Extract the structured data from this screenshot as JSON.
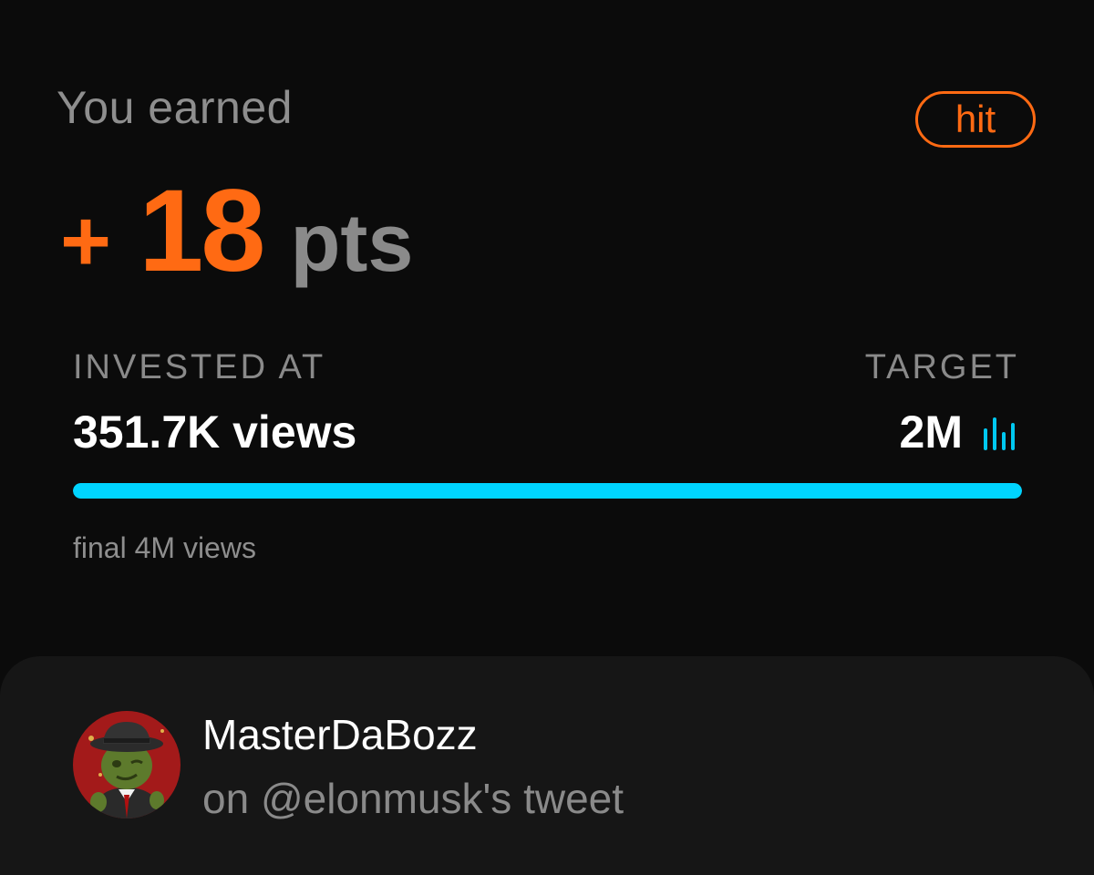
{
  "result": {
    "earned_label": "You earned",
    "badge": "hit",
    "points_sign": "+",
    "points_value": "18",
    "points_unit": "pts"
  },
  "investment": {
    "invested_label": "INVESTED AT",
    "invested_value": "351.7K views",
    "target_label": "TARGET",
    "target_value": "2M",
    "target_icon": "bar-chart-icon",
    "progress_fraction": 1.0,
    "final_text": "final 4M views"
  },
  "post": {
    "user_name": "MasterDaBozz",
    "subtitle": "on @elonmusk's tweet",
    "avatar_icon": "avatar-image"
  },
  "colors": {
    "background": "#0b0b0b",
    "card": "#161616",
    "accent_orange": "#ff6a13",
    "accent_cyan": "#00d4ff",
    "muted_text": "#8a8a8a",
    "text": "#ffffff"
  }
}
